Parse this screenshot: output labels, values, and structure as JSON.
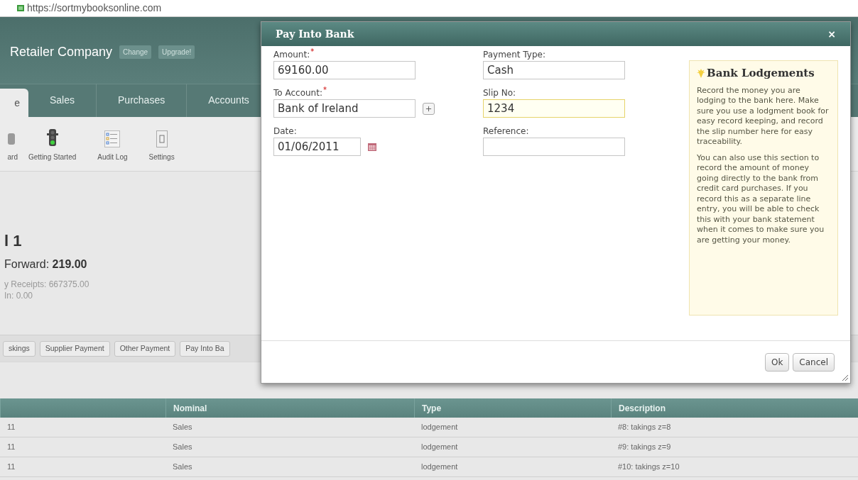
{
  "url": "https://sortmybooksonline.com",
  "header": {
    "company": "Retailer Company",
    "buttons": [
      "Change",
      "Upgrade!"
    ]
  },
  "tabs": [
    {
      "label": "e",
      "selected": true
    },
    {
      "label": "Sales",
      "selected": false
    },
    {
      "label": "Purchases",
      "selected": false
    },
    {
      "label": "Accounts",
      "selected": false
    }
  ],
  "toolbar": [
    {
      "label": "ard",
      "kind": "dashboard"
    },
    {
      "label": "Getting Started",
      "kind": "traffic"
    },
    {
      "label": "Audit Log",
      "kind": "log"
    },
    {
      "label": "Settings",
      "kind": "switch"
    }
  ],
  "summary": {
    "heading": "l 1",
    "forward": "Forward: **219.00**",
    "lines": [
      "y Receipts: 667375.00",
      "In: 0.00"
    ]
  },
  "action_buttons": [
    "skings",
    "Supplier Payment",
    "Other Payment",
    "Pay Into Ba"
  ],
  "table": {
    "columns": [
      "",
      "Nominal",
      "Type",
      "Description"
    ],
    "rows": [
      [
        "11",
        "Sales",
        "lodgement",
        "#8: takings z=8"
      ],
      [
        "11",
        "Sales",
        "lodgement",
        "#9: takings z=9"
      ],
      [
        "11",
        "Sales",
        "lodgement",
        "#10: takings z=10"
      ]
    ]
  },
  "dialog": {
    "title": "Pay Into Bank",
    "close": "×",
    "fields": [
      {
        "label": "Amount:",
        "required_mark": "*",
        "value": "69160.00",
        "kind": "text",
        "focused": false
      },
      {
        "label": "Payment Type:",
        "value": "Cash",
        "kind": "text",
        "focused": false
      },
      {
        "label": "To Account:",
        "required_mark": "*",
        "value": "Bank of Ireland",
        "kind": "account",
        "focused": false
      },
      {
        "label": "Slip No:",
        "value": "1234",
        "kind": "text",
        "focused": true
      },
      {
        "label": "Date:",
        "value": "01/06/2011",
        "kind": "date",
        "focused": false
      },
      {
        "label": "Reference:",
        "kind": "text",
        "focused": false
      }
    ],
    "help": {
      "title": "Bank Lodgements",
      "paragraphs": [
        "Record the money you are lodging to the bank here. Make sure you use a lodgment book for easy record keeping, and record the slip number here for easy traceability.",
        "You can also use this section to record the amount of money going directly to the bank from credit card purchases. If you record this as a separate line entry, you will be able to check this with your bank statement when it comes to make sure you are getting your money."
      ]
    },
    "buttons": [
      "Ok",
      "Cancel"
    ]
  }
}
